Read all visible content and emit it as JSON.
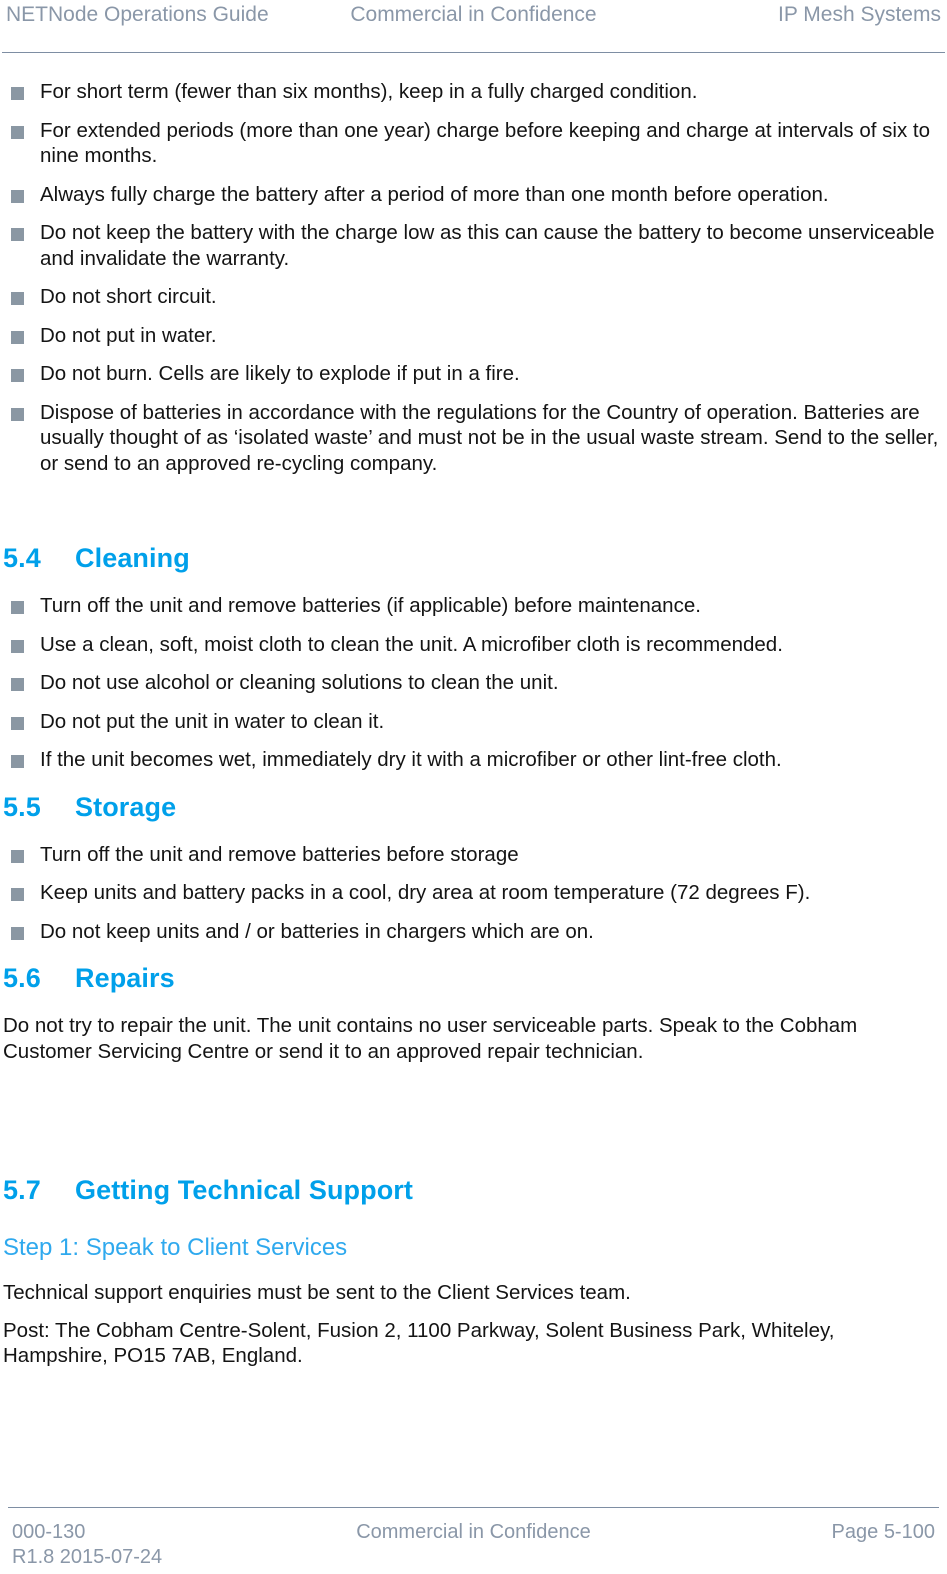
{
  "header": {
    "left": "NETNode Operations Guide",
    "center": "Commercial in Confidence",
    "right": "IP Mesh Systems"
  },
  "colors": {
    "heading_blue": "#00A0EA",
    "substep_blue": "#2FA9EE",
    "bullet_square": "#8A97A3",
    "header_footer_text": "#8A97A8",
    "rule": "#7E8EA3",
    "body_text": "#141414"
  },
  "battery_bullets": [
    "For short term (fewer than six months), keep in a fully charged condition.",
    "For extended periods (more than one year) charge before keeping and charge at intervals of six to nine months.",
    "Always fully charge the battery after a period of more than one month before operation.",
    "Do not keep the battery with the charge low as this can cause the battery to become unserviceable and invalidate the warranty.",
    "Do not short circuit.",
    "Do not put in water.",
    "Do not burn. Cells are likely to explode if put in a fire.",
    "Dispose of batteries in accordance with the regulations for the Country of operation. Batteries are usually thought of as ‘isolated waste’ and must not be in the usual waste stream. Send to the seller, or send to an approved re-cycling company."
  ],
  "sections": {
    "cleaning": {
      "number": "5.4",
      "title": "Cleaning",
      "bullets": [
        "Turn off the unit and remove batteries (if applicable) before maintenance.",
        "Use a clean, soft, moist cloth to clean the unit. A microfiber cloth is recommended.",
        "Do not use alcohol or cleaning solutions to clean the unit.",
        "Do not put the unit in water to clean it.",
        "If the unit becomes wet, immediately dry it with a microfiber or other lint-free cloth."
      ]
    },
    "storage": {
      "number": "5.5",
      "title": "Storage",
      "bullets": [
        "Turn off the unit and remove batteries before storage",
        "Keep units and battery packs in a cool, dry area at room temperature (72 degrees F).",
        "Do not keep units and / or batteries in chargers which are on."
      ]
    },
    "repairs": {
      "number": "5.6",
      "title": "Repairs",
      "paragraph": "Do not try to repair the unit. The unit contains no user serviceable parts. Speak to the Cobham Customer Servicing Centre or send it to an approved repair technician."
    },
    "support": {
      "number": "5.7",
      "title": "Getting Technical Support",
      "step_heading": "Step 1: Speak to Client Services",
      "paragraph_1": "Technical support enquiries must be sent to the Client Services team.",
      "paragraph_2": "Post: The Cobham Centre-Solent, Fusion 2, 1100 Parkway, Solent Business Park, Whiteley, Hampshire, PO15 7AB, England."
    }
  },
  "footer": {
    "left": "000-130\nR1.8 2015-07-24",
    "center": "Commercial in Confidence",
    "right": "Page 5-100"
  }
}
